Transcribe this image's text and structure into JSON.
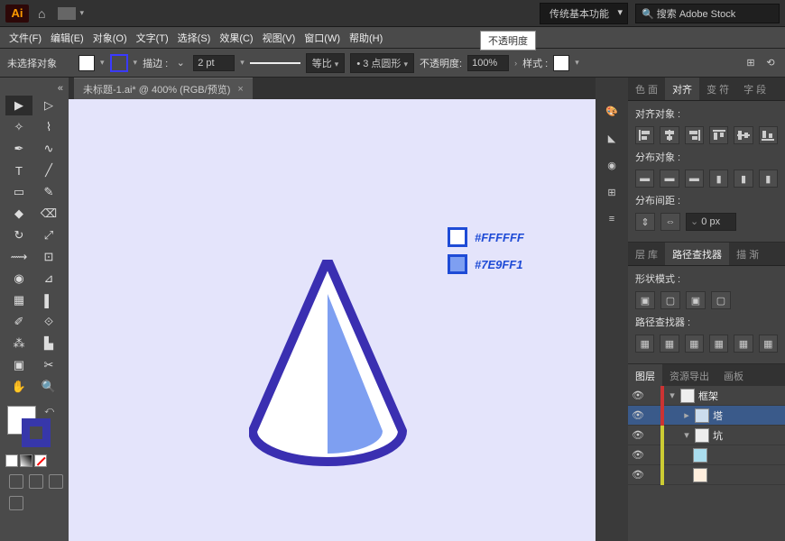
{
  "top": {
    "workspace": "传统基本功能",
    "search_ph": "搜索 Adobe Stock"
  },
  "menu": [
    "文件(F)",
    "编辑(E)",
    "对象(O)",
    "文字(T)",
    "选择(S)",
    "效果(C)",
    "视图(V)",
    "窗口(W)",
    "帮助(H)"
  ],
  "tooltip": "不透明度",
  "ctrl": {
    "nosel": "未选择对象",
    "stroke_lbl": "描边 :",
    "stroke_val": "2 pt",
    "scale": "等比",
    "brush": "3 点圆形",
    "opac_lbl": "不透明度:",
    "opac_val": "100%",
    "style_lbl": "样式 :"
  },
  "tab": {
    "title": "未标题-1.ai* @ 400% (RGB/预览)"
  },
  "legend": [
    {
      "hex": "#FFFFFF",
      "color": "#ffffff"
    },
    {
      "hex": "#7E9FF1",
      "color": "#7e9ff1"
    }
  ],
  "ptabs": [
    "色 面",
    "对齐",
    "变 符",
    "字 段"
  ],
  "align": {
    "sec1": "对齐对象 :",
    "sec2": "分布对象 :",
    "sec3": "分布间距 :",
    "spacing": "0 px"
  },
  "pf_tabs": [
    "层 库",
    "路径查找器",
    "描 渐"
  ],
  "pf": {
    "shape": "形状模式 :",
    "pf_lbl": "路径查找器 :"
  },
  "lyr_tabs": [
    "图层",
    "资源导出",
    "画板"
  ],
  "layers": [
    {
      "name": "框架",
      "indent": 0,
      "ind": "red",
      "caret": "▾"
    },
    {
      "name": "塔",
      "indent": 1,
      "ind": "red",
      "sel": true,
      "caret": "▸"
    },
    {
      "name": "坑",
      "indent": 1,
      "ind": "yel",
      "caret": "▾"
    },
    {
      "name": "",
      "indent": 2,
      "ind": "yel",
      "caret": ""
    },
    {
      "name": "",
      "indent": 2,
      "ind": "yel",
      "caret": ""
    }
  ]
}
